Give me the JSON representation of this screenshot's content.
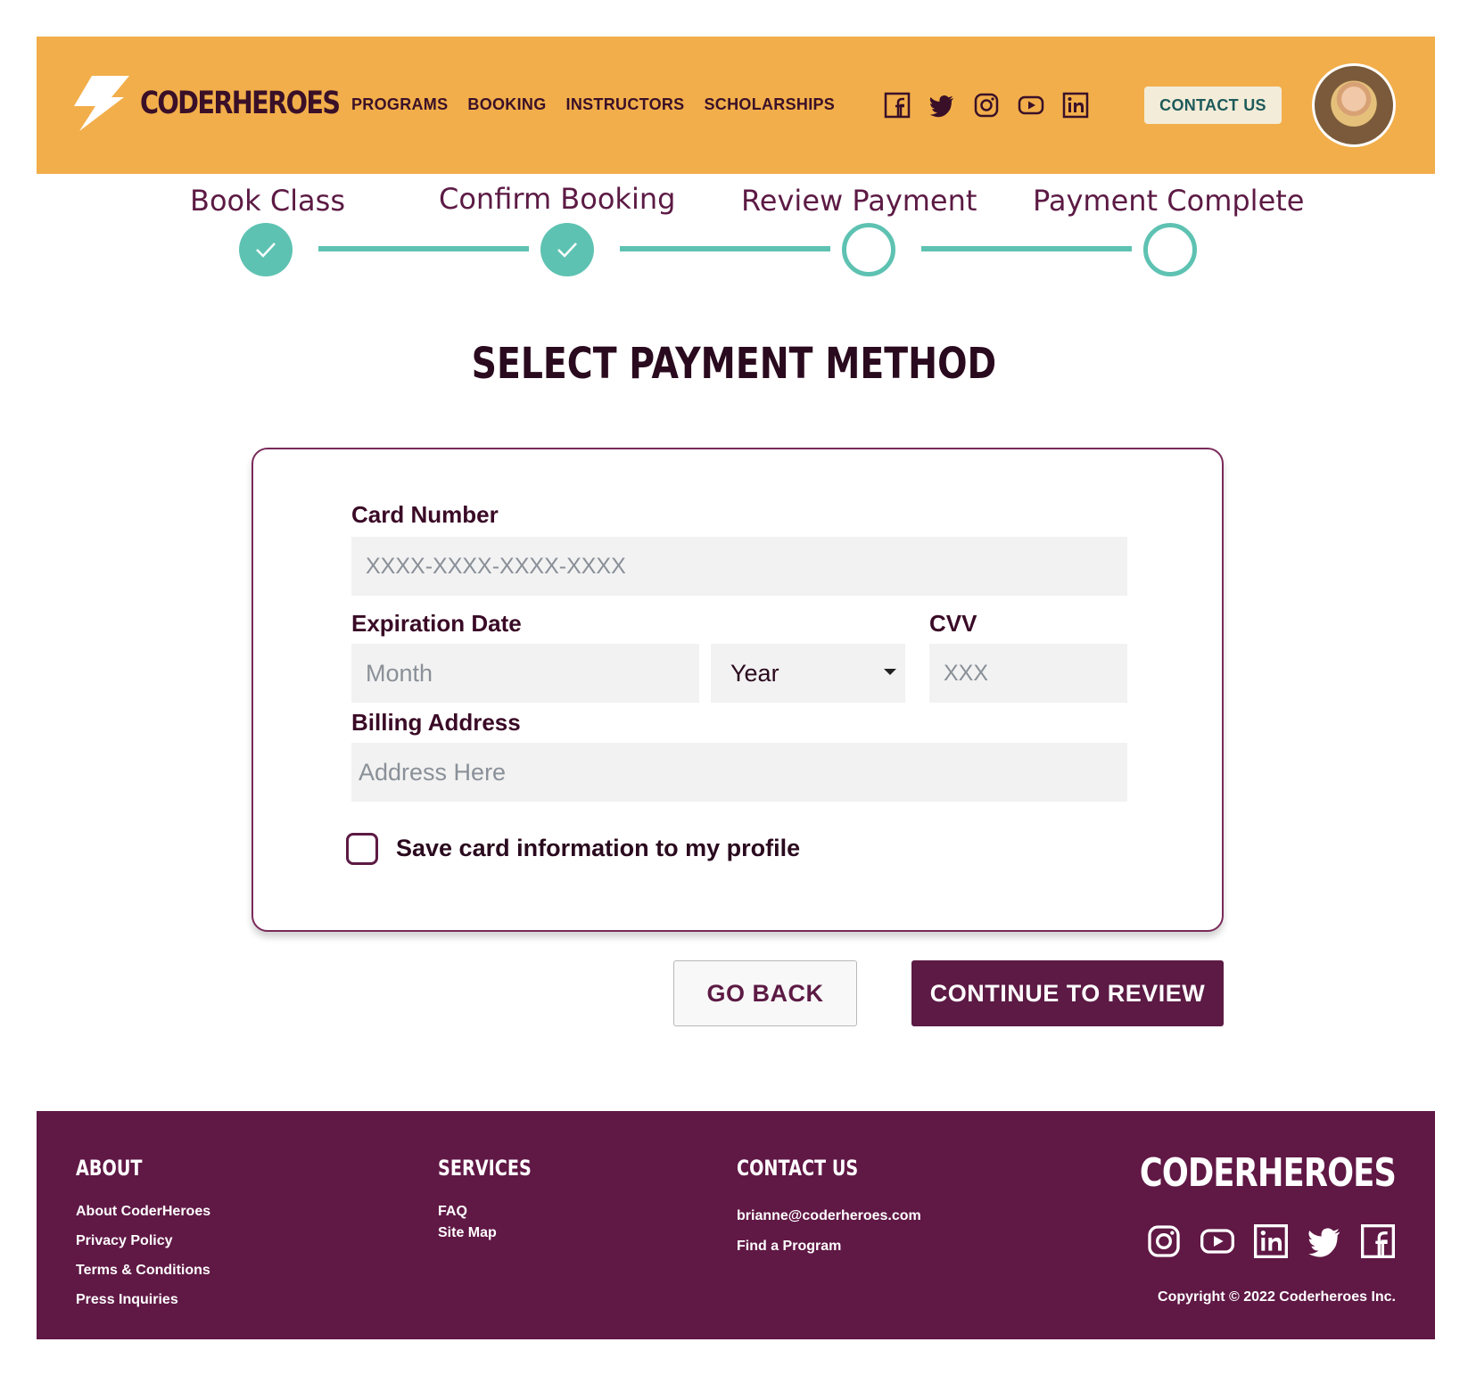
{
  "brand": {
    "name": "CODERHEROES"
  },
  "nav": {
    "items": [
      "PROGRAMS",
      "BOOKING",
      "INSTRUCTORS",
      "SCHOLARSHIPS"
    ],
    "contact_label": "CONTACT US"
  },
  "social": [
    "facebook-icon",
    "twitter-icon",
    "instagram-icon",
    "youtube-icon",
    "linkedin-icon"
  ],
  "stepper": {
    "steps": [
      {
        "label": "Book Class",
        "status": "complete"
      },
      {
        "label": "Confirm Booking",
        "status": "complete"
      },
      {
        "label": "Review Payment",
        "status": "incomplete"
      },
      {
        "label": "Payment Complete",
        "status": "incomplete"
      }
    ]
  },
  "page": {
    "title": "SELECT PAYMENT METHOD"
  },
  "form": {
    "card_number_label": "Card Number",
    "card_number_placeholder": "XXXX-XXXX-XXXX-XXXX",
    "expiration_label": "Expiration Date",
    "month_placeholder": "Month",
    "year_value": "Year",
    "cvv_label": "CVV",
    "cvv_placeholder": "XXX",
    "billing_label": "Billing Address",
    "billing_placeholder": "Address Here",
    "save_card_label": "Save card information to my profile",
    "save_card_checked": false
  },
  "actions": {
    "back_label": "GO BACK",
    "continue_label": "CONTINUE TO REVIEW"
  },
  "footer": {
    "about_heading": "ABOUT",
    "about_links": [
      "About CoderHeroes",
      "Privacy Policy",
      "Terms & Conditions",
      "Press Inquiries"
    ],
    "services_heading": "SERVICES",
    "services_links": [
      "FAQ",
      "Site Map"
    ],
    "contact_heading": "CONTACT US",
    "contact_links": [
      "brianne@coderheroes.com",
      "Find a Program"
    ],
    "brand": "CODERHEROES",
    "social": [
      "instagram-icon",
      "youtube-icon",
      "linkedin-icon",
      "twitter-icon",
      "facebook-icon"
    ],
    "copyright": "Copyright © 2022 Coderheroes Inc."
  },
  "colors": {
    "header_bg": "#f2ae4a",
    "brand_plum": "#5c1a44",
    "footer_bg": "#601845",
    "step_teal": "#5ec2b2"
  }
}
